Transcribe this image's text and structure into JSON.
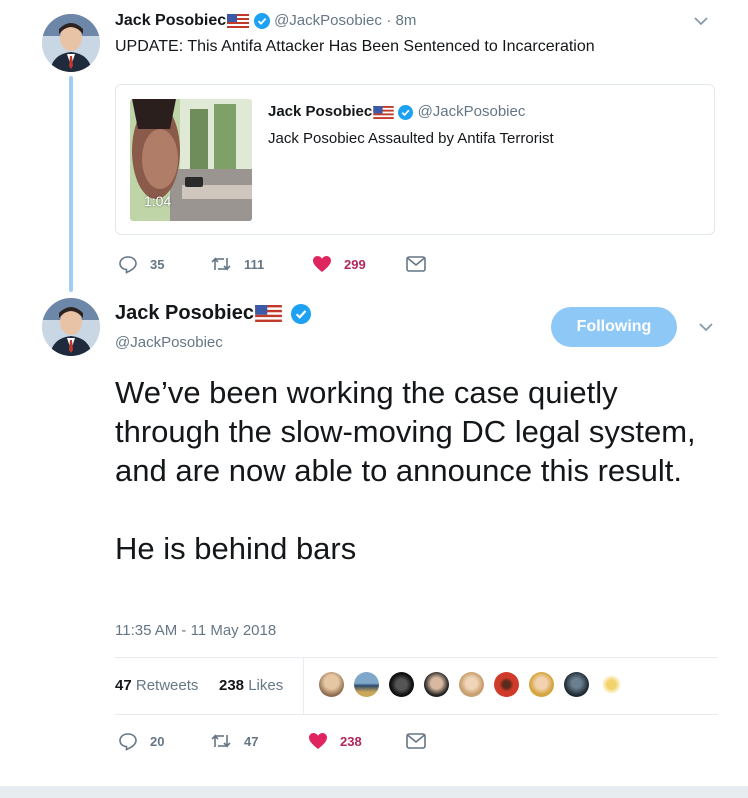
{
  "tweet1": {
    "display_name": "Jack Posobiec",
    "handle": "@JackPosobiec",
    "time": "· 8m",
    "text": "UPDATE: This Antifa Attacker Has Been Sentenced to Incarceration",
    "quoted": {
      "display_name": "Jack Posobiec",
      "handle": "@JackPosobiec",
      "text": "Jack Posobiec Assaulted by Antifa Terrorist",
      "video_duration": "1:04"
    },
    "actions": {
      "replies": "35",
      "retweets": "111",
      "likes": "299"
    }
  },
  "tweet2": {
    "display_name": "Jack Posobiec",
    "handle": "@JackPosobiec",
    "follow_label": "Following",
    "text_paragraph1": "We’ve been working the case quietly through the slow-moving DC legal system, and are now able to announce this result.",
    "text_paragraph2": "He is behind bars",
    "timestamp": "11:35 AM - 11 May 2018",
    "stats": {
      "retweets_count": "47",
      "retweets_label": "Retweets",
      "likes_count": "238",
      "likes_label": "Likes"
    },
    "actions": {
      "replies": "20",
      "retweets": "47",
      "likes": "238"
    }
  },
  "colors": {
    "accent": "#1da1f2",
    "follow_button": "#8ec8f7",
    "liked": "#b0275e",
    "muted": "#657786",
    "thread_line": "#9fcdf5"
  },
  "icons": [
    "reply-icon",
    "retweet-icon",
    "heart-icon",
    "mail-icon",
    "chevron-down-icon",
    "verified-icon",
    "us-flag-icon"
  ]
}
